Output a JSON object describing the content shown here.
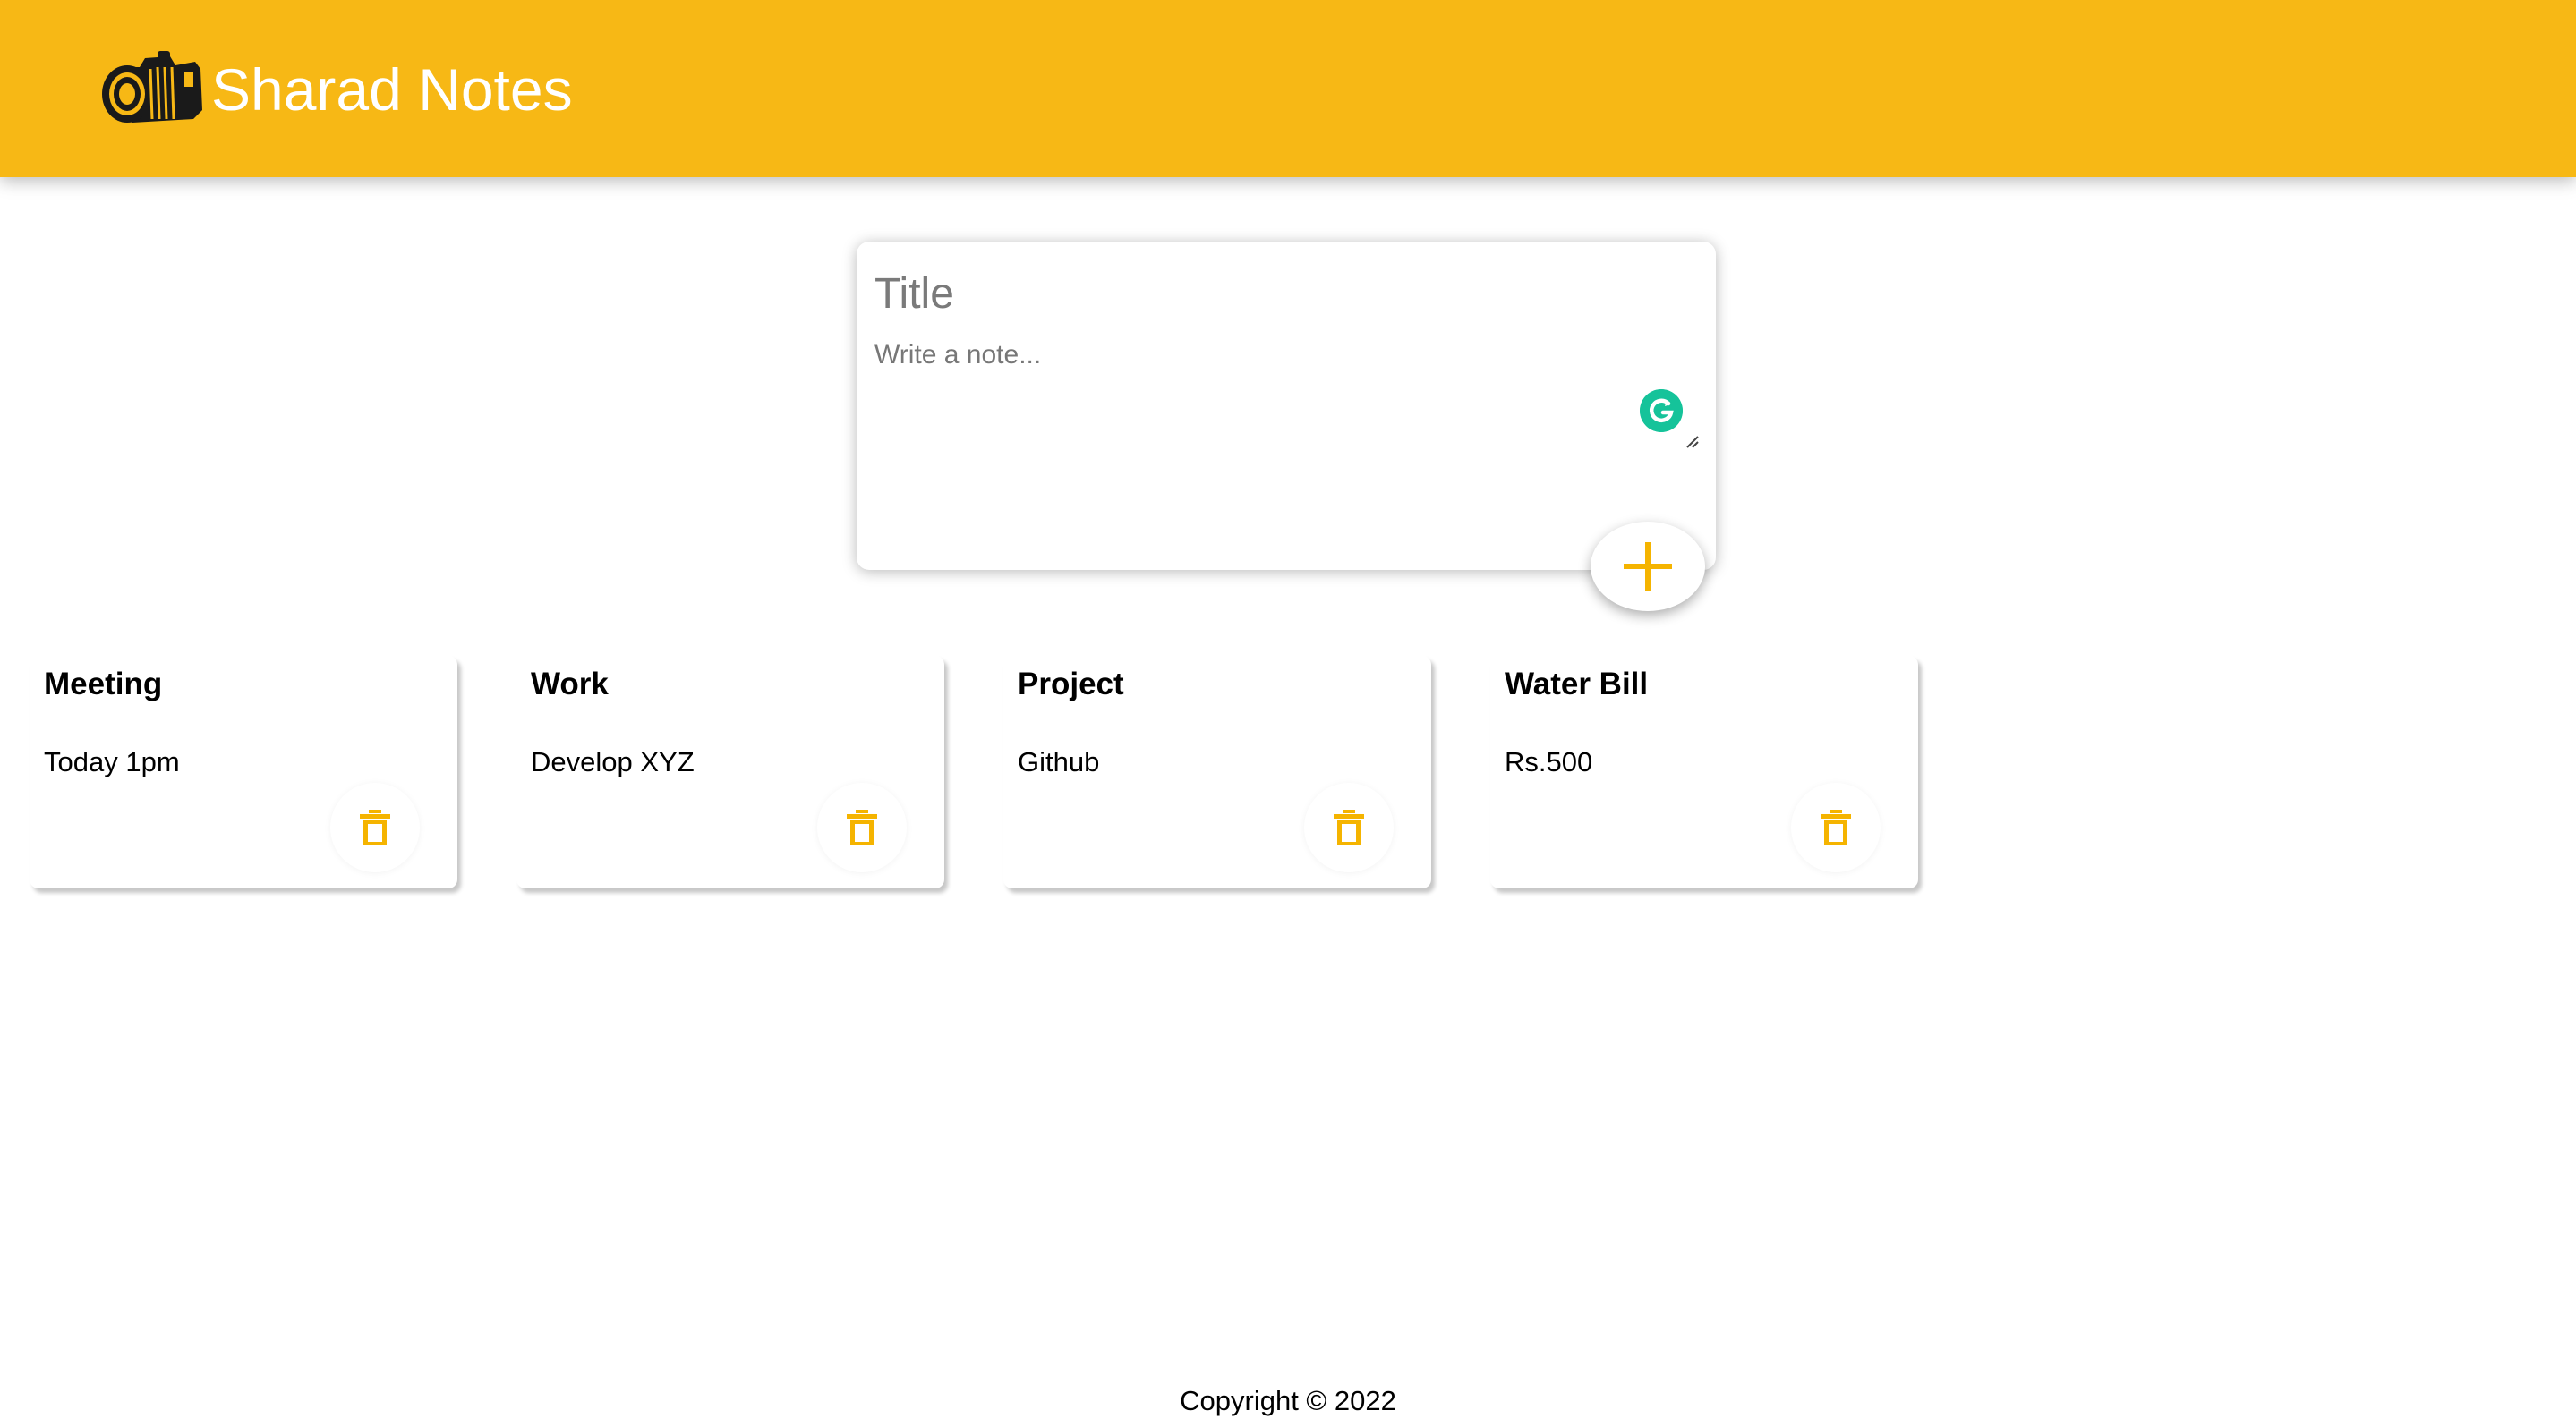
{
  "header": {
    "title": "Sharad Notes",
    "logo_icon": "camera-icon"
  },
  "create_note": {
    "title_placeholder": "Title",
    "content_placeholder": "Write a note...",
    "add_icon": "plus-icon",
    "extension_icon": "grammarly-icon"
  },
  "notes": [
    {
      "title": "Meeting",
      "content": "Today 1pm"
    },
    {
      "title": "Work",
      "content": "Develop XYZ"
    },
    {
      "title": "Project",
      "content": "Github"
    },
    {
      "title": "Water Bill",
      "content": "Rs.500"
    }
  ],
  "note_delete_icon": "trash-icon",
  "footer": {
    "text": "Copyright © 2022"
  },
  "colors": {
    "brand": "#f7b815",
    "header_text": "#ffffff",
    "grammarly": "#15c39a"
  }
}
